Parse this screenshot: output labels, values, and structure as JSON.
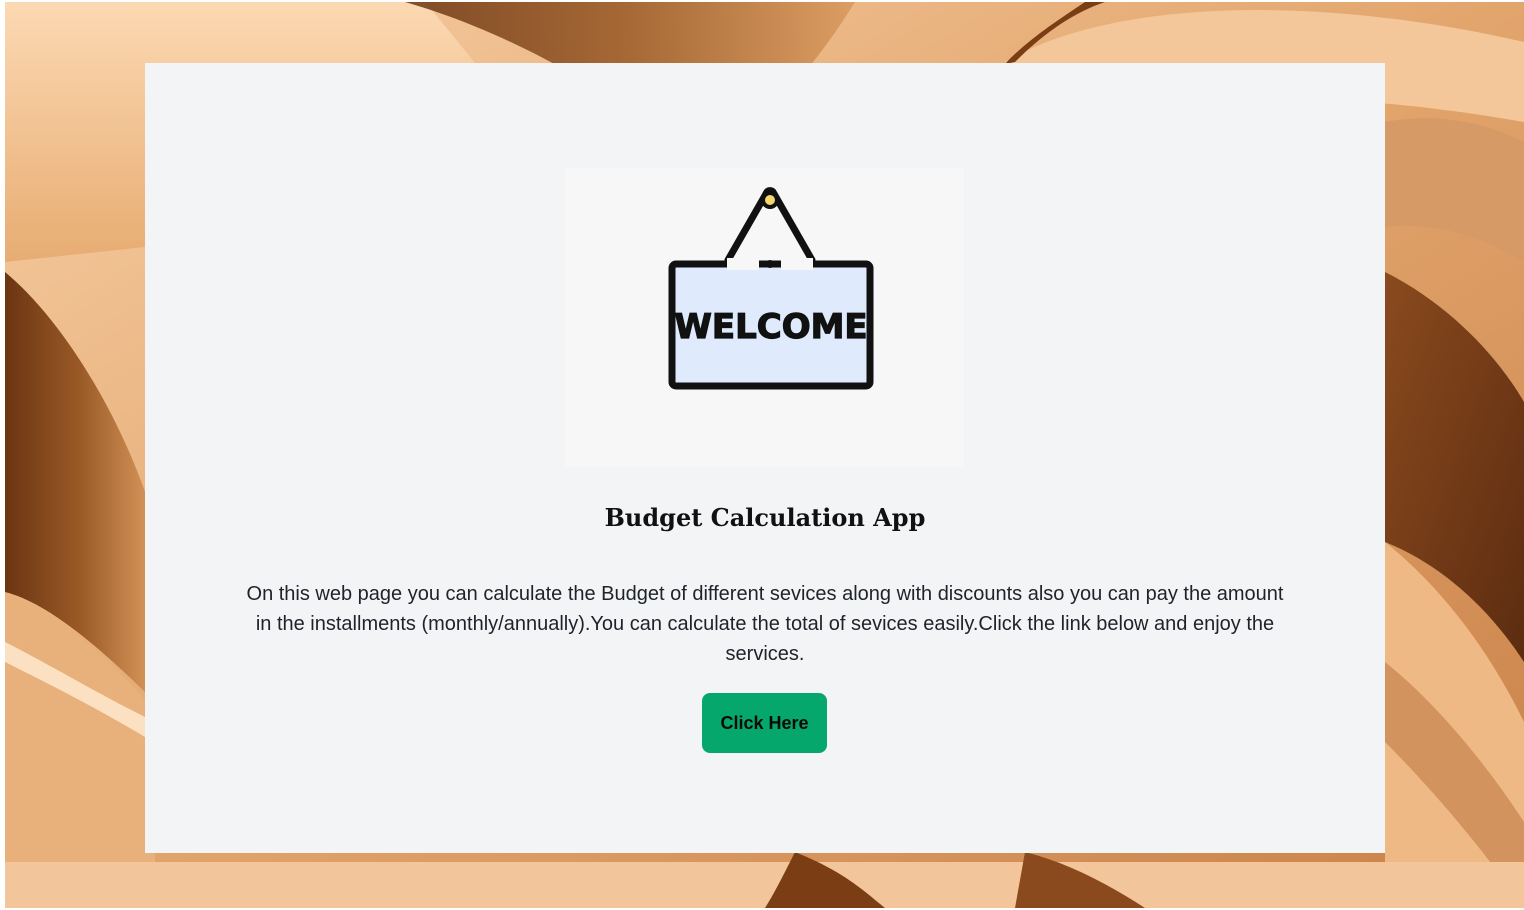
{
  "hero": {
    "sign_text": "WELCOME",
    "title": "Budget Calculation App",
    "description": "On this web page you can calculate the Budget of different sevices along with discounts also you can pay the amount in the installments (monthly/annually).You can calculate the total of sevices easily.Click the link below and enjoy the services.",
    "button_label": "Click Here"
  },
  "colors": {
    "card_background": "#f2f4f6",
    "button_background": "#06a76c",
    "sign_fill": "#dfeafc",
    "sign_stroke": "#111111",
    "nail": "#f5d76e"
  },
  "icons": {
    "welcome_sign": "welcome-sign-icon"
  }
}
